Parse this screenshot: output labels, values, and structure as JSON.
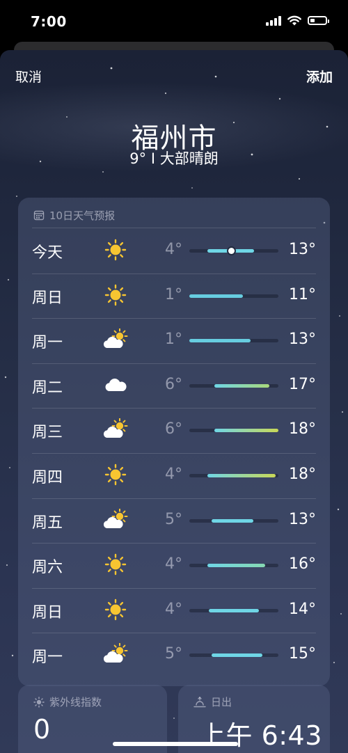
{
  "status_bar": {
    "time": "7:00"
  },
  "nav": {
    "cancel_label": "取消",
    "add_label": "添加"
  },
  "location": {
    "city": "福州市",
    "summary": "9° I 大部晴朗"
  },
  "forecast": {
    "header": "10日天气预报",
    "days": [
      {
        "day": "今天",
        "icon": "sun-icon",
        "low": "4°",
        "high": "13°",
        "range_start": 0.2,
        "range_end": 0.73,
        "current": 0.47,
        "fill_color": "#6fd6e6"
      },
      {
        "day": "周日",
        "icon": "sun-icon",
        "low": "1°",
        "high": "11°",
        "range_start": 0.0,
        "range_end": 0.6,
        "fill_color": "#67cde0"
      },
      {
        "day": "周一",
        "icon": "partly-cloudy-icon",
        "low": "1°",
        "high": "13°",
        "range_start": 0.0,
        "range_end": 0.69,
        "fill_color": "#67cde0"
      },
      {
        "day": "周二",
        "icon": "cloud-icon",
        "low": "6°",
        "high": "17°",
        "range_start": 0.28,
        "range_end": 0.9,
        "fill_color": "linear-gradient(90deg,#6fd6e6,#a9d97a)"
      },
      {
        "day": "周三",
        "icon": "partly-cloudy-icon",
        "low": "6°",
        "high": "18°",
        "range_start": 0.28,
        "range_end": 1.0,
        "fill_color": "linear-gradient(90deg,#6fd6e6,#c9d857)"
      },
      {
        "day": "周四",
        "icon": "sun-icon",
        "low": "4°",
        "high": "18°",
        "range_start": 0.2,
        "range_end": 0.97,
        "fill_color": "linear-gradient(90deg,#6fd6e6,#c9d857)"
      },
      {
        "day": "周五",
        "icon": "partly-cloudy-icon",
        "low": "5°",
        "high": "13°",
        "range_start": 0.25,
        "range_end": 0.72,
        "fill_color": "#6fd6e6"
      },
      {
        "day": "周六",
        "icon": "sun-icon",
        "low": "4°",
        "high": "16°",
        "range_start": 0.2,
        "range_end": 0.85,
        "fill_color": "linear-gradient(90deg,#6fd6e6,#86d8b2)"
      },
      {
        "day": "周日",
        "icon": "sun-icon",
        "low": "4°",
        "high": "14°",
        "range_start": 0.22,
        "range_end": 0.78,
        "fill_color": "#6fd6e6"
      },
      {
        "day": "周一",
        "icon": "partly-cloudy-icon",
        "low": "5°",
        "high": "15°",
        "range_start": 0.25,
        "range_end": 0.82,
        "fill_color": "#6fd6e6"
      }
    ]
  },
  "uv": {
    "header": "紫外线指数",
    "value": "0"
  },
  "sunrise": {
    "header": "日出",
    "value": "上午 6:43"
  },
  "colors": {
    "sun": "#f7c531",
    "cloud": "#ffffff"
  }
}
